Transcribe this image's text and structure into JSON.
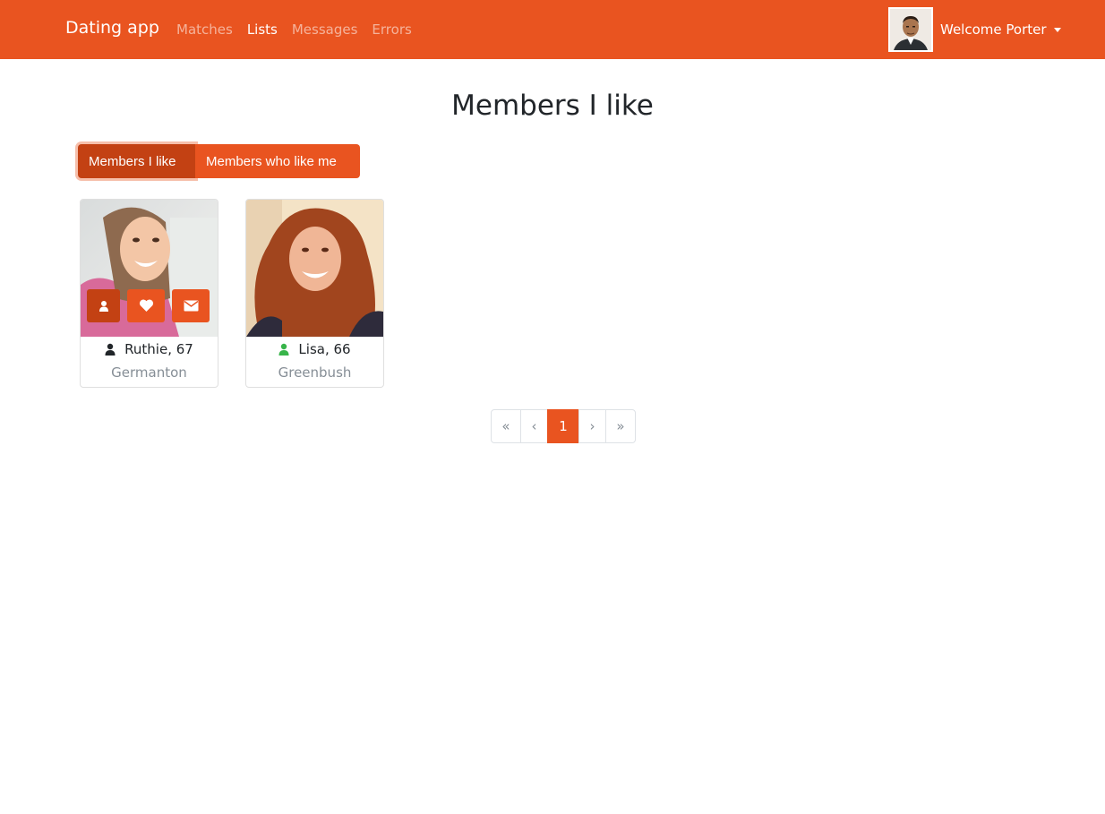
{
  "nav": {
    "brand": "Dating app",
    "links": [
      "Matches",
      "Lists",
      "Messages",
      "Errors"
    ],
    "active_link": "Lists",
    "welcome": "Welcome Porter"
  },
  "page": {
    "title": "Members I like"
  },
  "filters": {
    "option1": "Members I like",
    "option2": "Members who like me"
  },
  "members": [
    {
      "name_age": "Ruthie, 67",
      "city": "Germanton",
      "online": false
    },
    {
      "name_age": "Lisa, 66",
      "city": "Greenbush",
      "online": true
    }
  ],
  "pagination": {
    "first": "«",
    "prev": "‹",
    "current": "1",
    "next": "›",
    "last": "»"
  },
  "colors": {
    "primary": "#E95420",
    "primary_dark": "#C34113",
    "online": "#38B44A",
    "muted": "#868e96"
  }
}
